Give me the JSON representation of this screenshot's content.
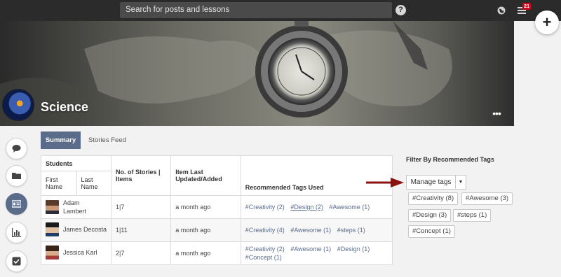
{
  "topbar": {
    "search_placeholder": "Search for posts and lessons",
    "help_label": "?",
    "notification_count": "21",
    "add_label": "+"
  },
  "banner": {
    "course_title": "Science",
    "more_label": "•••"
  },
  "tabs": [
    {
      "label": "Summary",
      "active": true
    },
    {
      "label": "Stories Feed",
      "active": false
    }
  ],
  "table": {
    "group_header": "Students",
    "headers": {
      "first_name": "First Name",
      "last_name": "Last Name",
      "stories": "No. of Stories | Items",
      "updated": "Item Last Updated/Added",
      "tags": "Recommended Tags Used"
    },
    "rows": [
      {
        "name": "Adam Lambert",
        "stories": "1|7",
        "updated": "a month ago",
        "tags": [
          "#Creativity (2)",
          "#Design (2)",
          "#Awesome (1)"
        ]
      },
      {
        "name": "James Decosta",
        "stories": "1|11",
        "updated": "a month ago",
        "tags": [
          "#Creativity (4)",
          "#Awesome (1)",
          "#steps (1)"
        ]
      },
      {
        "name": "Jessica Karl",
        "stories": "2|7",
        "updated": "a month ago",
        "tags": [
          "#Creativity (2)",
          "#Awesome (1)",
          "#Design (1)",
          "#Concept (1)"
        ]
      }
    ]
  },
  "filter": {
    "title": "Filter By Recommended Tags",
    "manage_label": "Manage tags",
    "chips": [
      "#Creativity (8)",
      "#Awesome (3)",
      "#Design (3)",
      "#steps (1)",
      "#Concept (1)"
    ]
  },
  "colors": {
    "accent": "#5b6b8a",
    "topbar": "#2b2b2b",
    "arrow": "#8b1111",
    "badge": "#d0021b"
  }
}
